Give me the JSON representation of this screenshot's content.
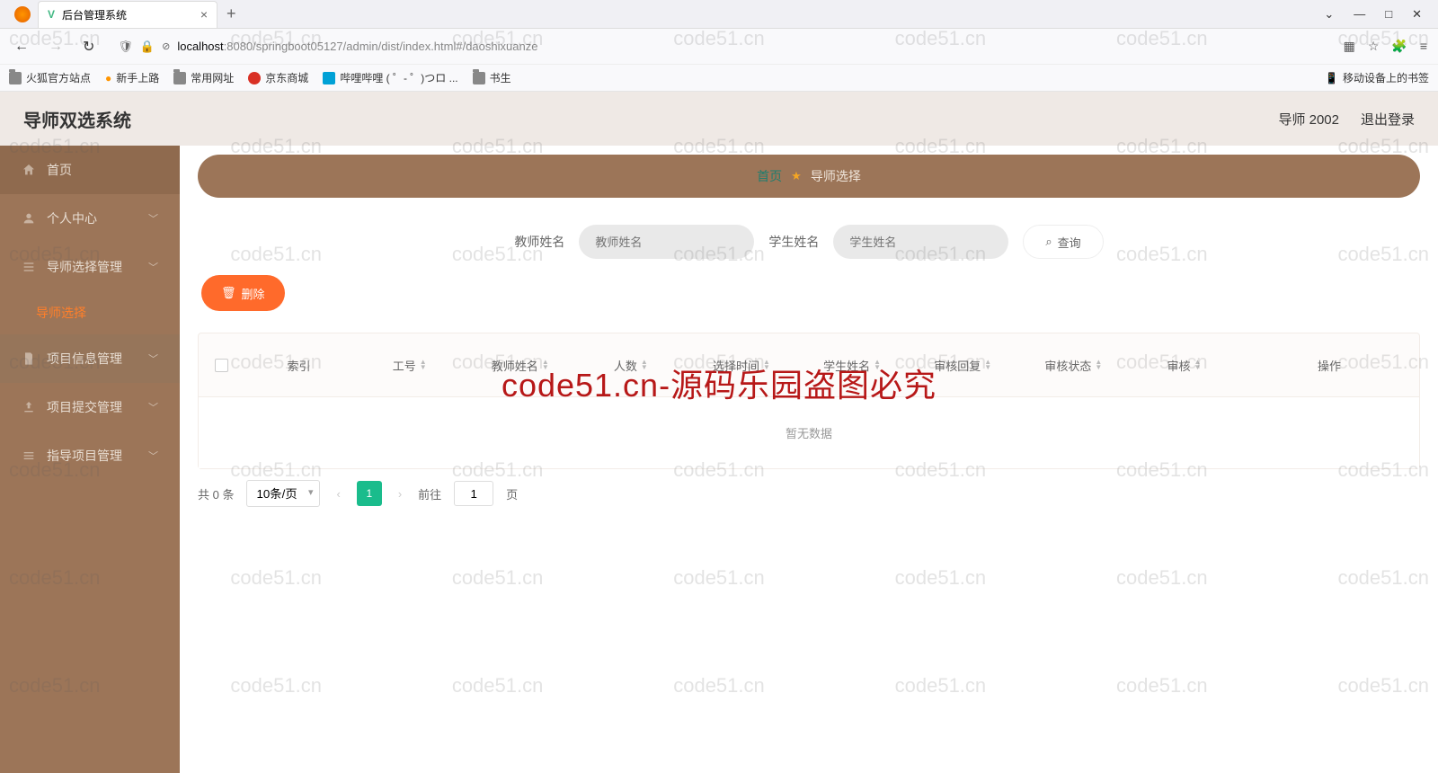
{
  "browser": {
    "tab_title": "后台管理系统",
    "url_host": "localhost",
    "url_path": ":8080/springboot05127/admin/dist/index.html#/daoshixuanze",
    "bookmarks": [
      "火狐官方站点",
      "新手上路",
      "常用网址",
      "京东商城",
      "哔哩哔哩 ( ゜- ゜)つロ ...",
      "书生"
    ],
    "bookmarks_right": "移动设备上的书签"
  },
  "header": {
    "title": "导师双选系统",
    "user": "导师 2002",
    "logout": "退出登录"
  },
  "sidebar": {
    "items": [
      {
        "label": "首页"
      },
      {
        "label": "个人中心"
      },
      {
        "label": "导师选择管理"
      },
      {
        "label": "导师选择"
      },
      {
        "label": "项目信息管理"
      },
      {
        "label": "项目提交管理"
      },
      {
        "label": "指导项目管理"
      }
    ]
  },
  "breadcrumb": {
    "home": "首页",
    "current": "导师选择"
  },
  "search": {
    "teacher_label": "教师姓名",
    "teacher_placeholder": "教师姓名",
    "student_label": "学生姓名",
    "student_placeholder": "学生姓名",
    "query": "查询"
  },
  "actions": {
    "delete": "删除"
  },
  "table": {
    "columns": [
      "索引",
      "工号",
      "教师姓名",
      "人数",
      "选择时间",
      "学生姓名",
      "审核回复",
      "审核状态",
      "审核",
      "操作"
    ],
    "empty": "暂无数据"
  },
  "pagination": {
    "total": "共 0 条",
    "page_size": "10条/页",
    "current": "1",
    "goto_prefix": "前往",
    "goto_value": "1",
    "goto_suffix": "页"
  },
  "watermark": {
    "repeat": "code51.cn",
    "center": "code51.cn-源码乐园盗图必究"
  }
}
